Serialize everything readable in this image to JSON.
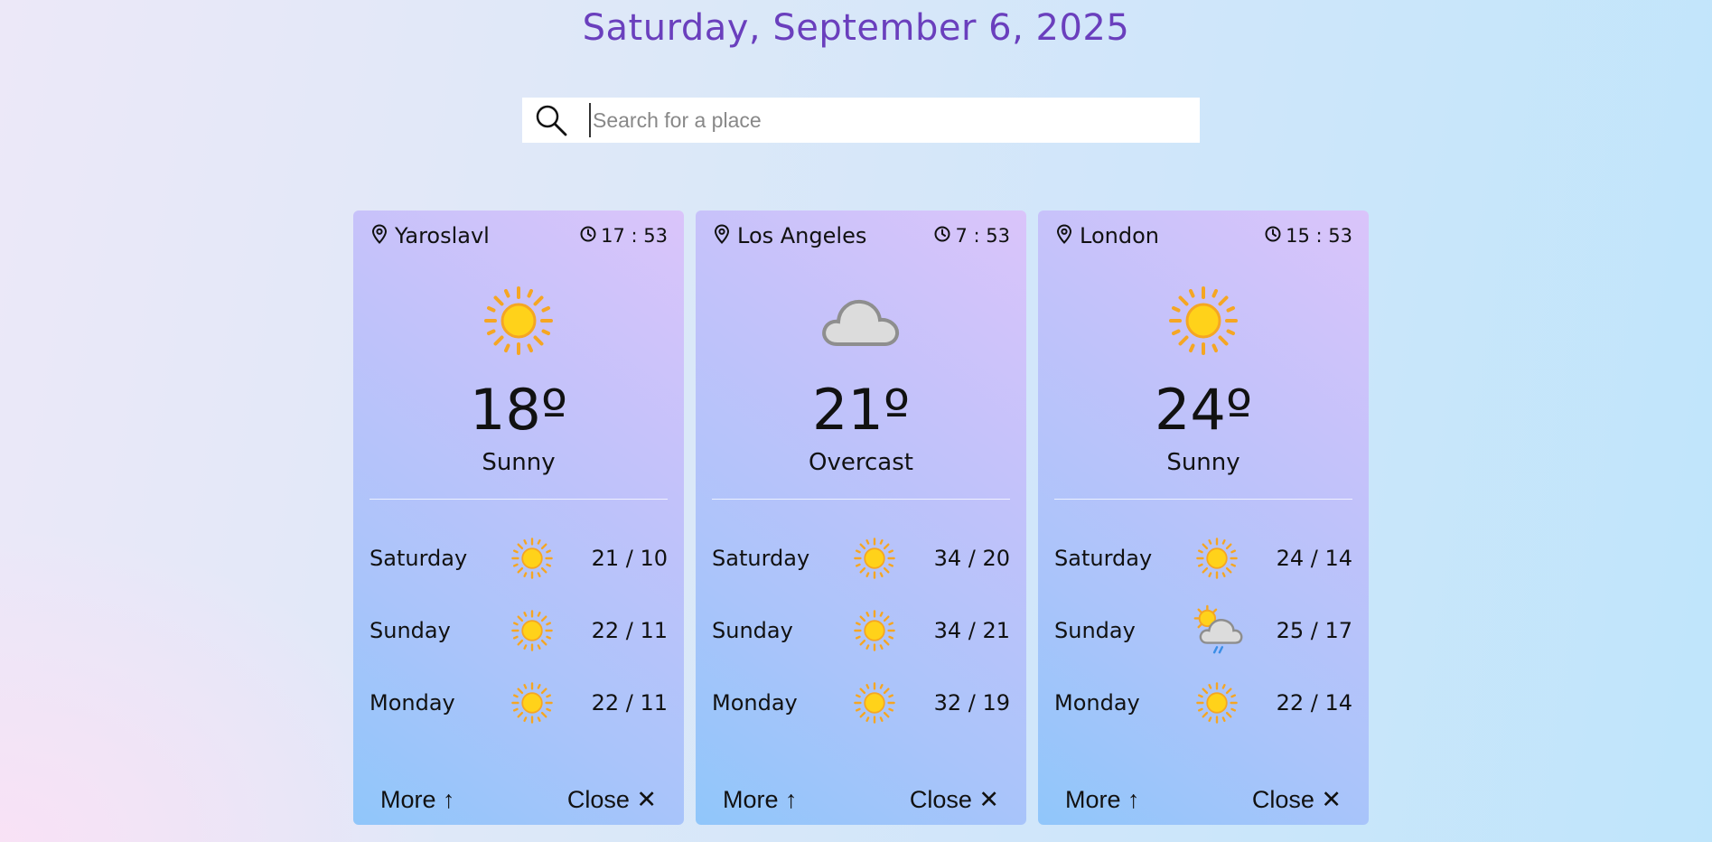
{
  "header": {
    "date": "Saturday, September 6, 2025"
  },
  "search": {
    "placeholder": "Search for a place",
    "value": ""
  },
  "cards": [
    {
      "location": "Yaroslavl",
      "time": "17 : 53",
      "icon": "sun-icon",
      "temp": "18º",
      "condition": "Sunny",
      "forecast": [
        {
          "day": "Saturday",
          "icon": "sun-icon",
          "range": "21 / 10"
        },
        {
          "day": "Sunday",
          "icon": "sun-icon",
          "range": "22 / 11"
        },
        {
          "day": "Monday",
          "icon": "sun-icon",
          "range": "22 / 11"
        }
      ],
      "more_label": "More ↑",
      "close_label": "Close ✕"
    },
    {
      "location": "Los Angeles",
      "time": "7 : 53",
      "icon": "cloud-icon",
      "temp": "21º",
      "condition": "Overcast",
      "forecast": [
        {
          "day": "Saturday",
          "icon": "sun-icon",
          "range": "34 / 20"
        },
        {
          "day": "Sunday",
          "icon": "sun-icon",
          "range": "34 / 21"
        },
        {
          "day": "Monday",
          "icon": "sun-icon",
          "range": "32 / 19"
        }
      ],
      "more_label": "More ↑",
      "close_label": "Close ✕"
    },
    {
      "location": "London",
      "time": "15 : 53",
      "icon": "sun-icon",
      "temp": "24º",
      "condition": "Sunny",
      "forecast": [
        {
          "day": "Saturday",
          "icon": "sun-icon",
          "range": "24 / 14"
        },
        {
          "day": "Sunday",
          "icon": "sun-cloud-rain-icon",
          "range": "25 / 17"
        },
        {
          "day": "Monday",
          "icon": "sun-icon",
          "range": "22 / 14"
        }
      ],
      "more_label": "More ↑",
      "close_label": "Close ✕"
    }
  ],
  "colors": {
    "title": "#6a3fbd",
    "sun": "#ffd21a",
    "sun_ray": "#f5a623",
    "cloud": "#d9d9d9",
    "rain": "#3a8ee6"
  }
}
